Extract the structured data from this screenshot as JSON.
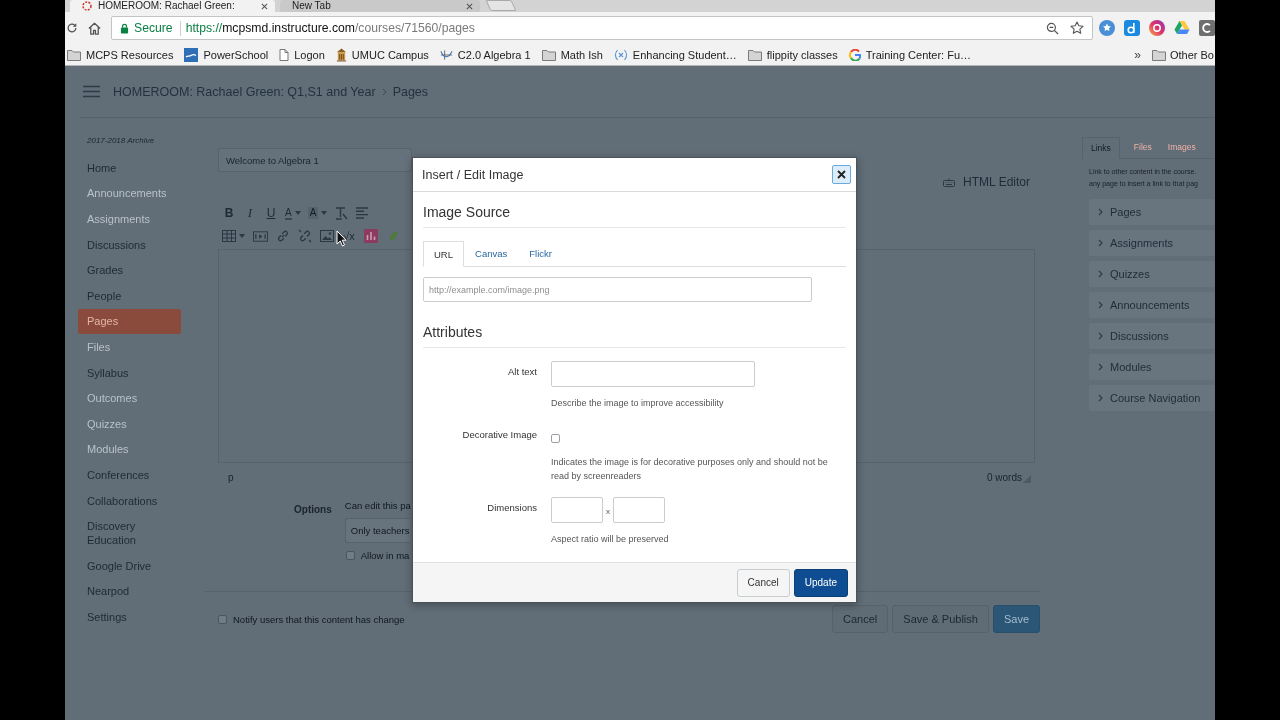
{
  "browser": {
    "tabs": [
      {
        "title": "HOMEROOM: Rachael Green:",
        "selected": true
      },
      {
        "title": "New Tab",
        "selected": false
      }
    ],
    "address": {
      "security": "Secure",
      "scheme": "https://",
      "host": "mcpsmd.instructure.com",
      "path": "/courses/71560/pages"
    },
    "bookmarks": [
      {
        "label": "MCPS Resources",
        "kind": "folder"
      },
      {
        "label": "PowerSchool",
        "kind": "tile"
      },
      {
        "label": "Logon",
        "kind": "page"
      },
      {
        "label": "UMUC Campus",
        "kind": "building"
      },
      {
        "label": "C2.0 Algebra 1",
        "kind": "graph"
      },
      {
        "label": "Math Ish",
        "kind": "folder"
      },
      {
        "label": "Enhancing Student…",
        "kind": "formula"
      },
      {
        "label": "flippity classes",
        "kind": "folder"
      },
      {
        "label": "Training Center: Fu…",
        "kind": "ring"
      }
    ],
    "overflow": "»",
    "other_bookmarks": {
      "label": "Other Bo",
      "kind": "folder"
    }
  },
  "header": {
    "breadcrumb": [
      "HOMEROOM: Rachael Green: Q1,S1 and Year",
      "Pages"
    ]
  },
  "sidebar": {
    "term": "2017-2018 Archive",
    "items": [
      {
        "label": "Home",
        "selected": false,
        "disabled": false
      },
      {
        "label": "Announcements",
        "selected": false,
        "disabled": true
      },
      {
        "label": "Assignments",
        "selected": false,
        "disabled": true
      },
      {
        "label": "Discussions",
        "selected": false,
        "disabled": false
      },
      {
        "label": "Grades",
        "selected": false,
        "disabled": false
      },
      {
        "label": "People",
        "selected": false,
        "disabled": false
      },
      {
        "label": "Pages",
        "selected": true,
        "disabled": false
      },
      {
        "label": "Files",
        "selected": false,
        "disabled": true
      },
      {
        "label": "Syllabus",
        "selected": false,
        "disabled": false
      },
      {
        "label": "Outcomes",
        "selected": false,
        "disabled": true
      },
      {
        "label": "Quizzes",
        "selected": false,
        "disabled": true
      },
      {
        "label": "Modules",
        "selected": false,
        "disabled": true
      },
      {
        "label": "Conferences",
        "selected": false,
        "disabled": false
      },
      {
        "label": "Collaborations",
        "selected": false,
        "disabled": false
      },
      {
        "label": "Discovery Education",
        "selected": false,
        "disabled": false
      },
      {
        "label": "Google Drive",
        "selected": false,
        "disabled": false
      },
      {
        "label": "Nearpod",
        "selected": false,
        "disabled": false
      },
      {
        "label": "Settings",
        "selected": false,
        "disabled": false
      }
    ]
  },
  "editor": {
    "title": "Welcome to Algebra 1",
    "html_editor": "HTML Editor",
    "toolbar": [
      [
        {
          "kind": "bold",
          "label": "B",
          "dropdown": false
        },
        {
          "kind": "italic",
          "label": "I",
          "dropdown": false
        },
        {
          "kind": "underline",
          "label": "U",
          "dropdown": false
        },
        {
          "kind": "text_color",
          "label": "A",
          "dropdown": true
        },
        {
          "kind": "highlight",
          "label": "A",
          "dropdown": true
        },
        {
          "kind": "clear_format",
          "dropdown": false
        },
        {
          "kind": "align",
          "dropdown": false
        }
      ],
      [
        {
          "kind": "table",
          "dropdown": true
        },
        {
          "kind": "media",
          "dropdown": false
        },
        {
          "kind": "link",
          "dropdown": false
        },
        {
          "kind": "unlink",
          "dropdown": false
        },
        {
          "kind": "image",
          "dropdown": false
        },
        {
          "kind": "equation",
          "label": "√x",
          "dropdown": false
        },
        {
          "kind": "chart",
          "dropdown": false
        },
        {
          "kind": "leaf",
          "dropdown": false
        }
      ]
    ],
    "element_path": "p",
    "word_count": "0 words",
    "options": {
      "label": "Options",
      "edit_label": "Can edit this pa",
      "edit_value": "Only teachers",
      "allow": {
        "label": "Allow in ma",
        "checked": false
      }
    },
    "notify": {
      "label": "Notify users that this content has change",
      "checked": false
    },
    "buttons": [
      {
        "label": "Cancel",
        "kind": "cancel"
      },
      {
        "label": "Save & Publish",
        "kind": "publish"
      },
      {
        "label": "Save",
        "kind": "save"
      }
    ]
  },
  "content_panel": {
    "tabs": [
      {
        "label": "Links",
        "selected": true
      },
      {
        "label": "Files",
        "selected": false
      },
      {
        "label": "Images",
        "selected": false
      }
    ],
    "description": [
      "Link to other content in the course.",
      "any page to insert a link to that pag"
    ],
    "sections": [
      {
        "label": "Pages",
        "expanded": false
      },
      {
        "label": "Assignments",
        "expanded": false
      },
      {
        "label": "Quizzes",
        "expanded": false
      },
      {
        "label": "Announcements",
        "expanded": false
      },
      {
        "label": "Discussions",
        "expanded": false
      },
      {
        "label": "Modules",
        "expanded": false
      },
      {
        "label": "Course Navigation",
        "expanded": false
      }
    ]
  },
  "dialog": {
    "title": "Insert / Edit Image",
    "source_heading": "Image Source",
    "source_tabs": [
      {
        "label": "URL",
        "selected": true
      },
      {
        "label": "Canvas",
        "selected": false
      },
      {
        "label": "Flickr",
        "selected": false
      }
    ],
    "url_placeholder": "http://example.com/image.png",
    "attributes_heading": "Attributes",
    "fields": [
      {
        "kind": "text",
        "label": "Alt text",
        "hint": "Describe the image to improve accessibility"
      },
      {
        "kind": "checkbox",
        "label": "Decorative Image",
        "checked": false,
        "hint": "Indicates the image is for decorative purposes only and should not be read by screenreaders"
      },
      {
        "kind": "size",
        "label": "Dimensions",
        "separator": "x",
        "hint": "Aspect ratio will be preserved"
      }
    ],
    "buttons": [
      {
        "label": "Cancel",
        "kind": "cancel"
      },
      {
        "label": "Update",
        "kind": "update"
      }
    ]
  }
}
